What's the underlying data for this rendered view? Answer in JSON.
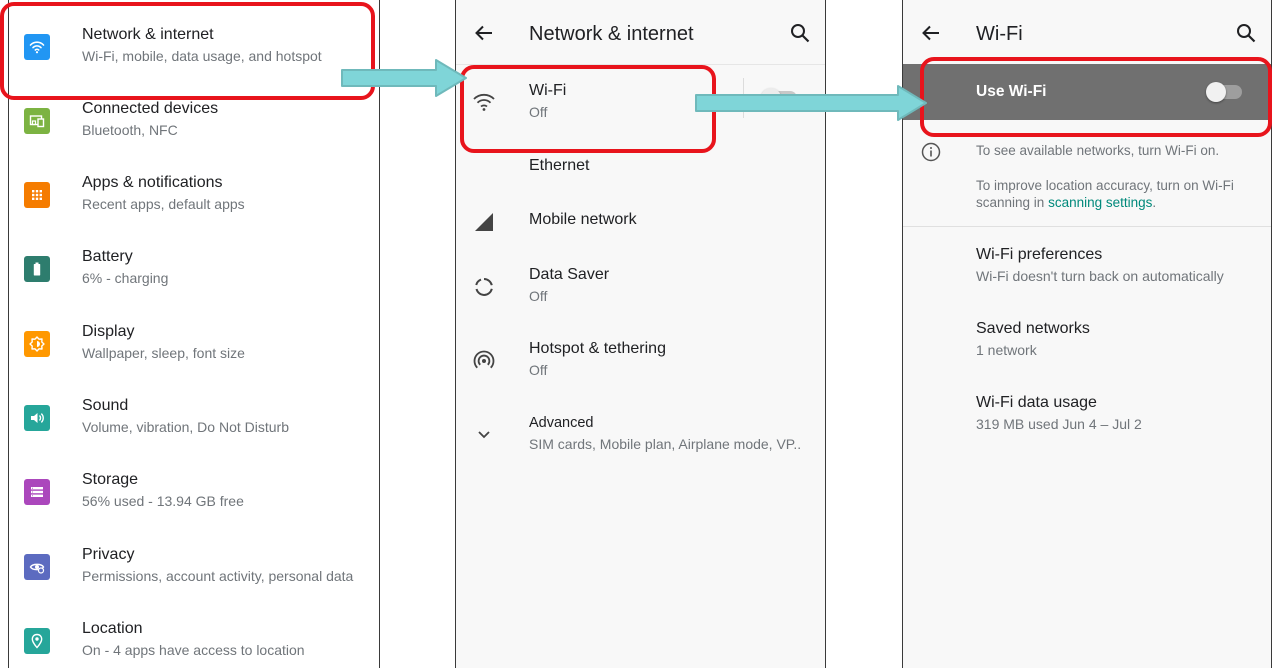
{
  "colors": {
    "highlight": "#e8141c",
    "arrow": "#7fd5d8",
    "link": "#00897b",
    "wifi_bar": "#707070"
  },
  "settings": {
    "items": [
      {
        "title": "Network & internet",
        "subtitle": "Wi-Fi, mobile, data usage, and hotspot",
        "icon": "wifi-icon",
        "color": "#2196f3"
      },
      {
        "title": "Connected devices",
        "subtitle": "Bluetooth, NFC",
        "icon": "connected-devices-icon",
        "color": "#7cb342"
      },
      {
        "title": "Apps & notifications",
        "subtitle": "Recent apps, default apps",
        "icon": "apps-grid-icon",
        "color": "#f57c00"
      },
      {
        "title": "Battery",
        "subtitle": "6% - charging",
        "icon": "battery-icon",
        "color": "#2e7d6e"
      },
      {
        "title": "Display",
        "subtitle": "Wallpaper, sleep, font size",
        "icon": "brightness-icon",
        "color": "#ff9800"
      },
      {
        "title": "Sound",
        "subtitle": "Volume, vibration, Do Not Disturb",
        "icon": "speaker-icon",
        "color": "#26a69a"
      },
      {
        "title": "Storage",
        "subtitle": "56% used - 13.94 GB free",
        "icon": "storage-icon",
        "color": "#ab47bc"
      },
      {
        "title": "Privacy",
        "subtitle": "Permissions, account activity, personal data",
        "icon": "privacy-eye-icon",
        "color": "#5c6bc0"
      },
      {
        "title": "Location",
        "subtitle": "On - 4 apps have access to location",
        "icon": "location-pin-icon",
        "color": "#26a69a"
      }
    ]
  },
  "network": {
    "title": "Network & internet",
    "items": [
      {
        "title": "Wi-Fi",
        "subtitle": "Off",
        "icon": "wifi-outline-icon"
      },
      {
        "title": "Ethernet",
        "subtitle": "",
        "icon": ""
      },
      {
        "title": "Mobile network",
        "subtitle": "",
        "icon": "signal-icon"
      },
      {
        "title": "Data Saver",
        "subtitle": "Off",
        "icon": "data-saver-icon"
      },
      {
        "title": "Hotspot & tethering",
        "subtitle": "Off",
        "icon": "hotspot-icon"
      },
      {
        "title": "Advanced",
        "subtitle": "SIM cards, Mobile plan, Airplane mode, VP..",
        "icon": "chevron-down-icon"
      }
    ]
  },
  "wifi": {
    "title": "Wi-Fi",
    "use_wifi_label": "Use Wi-Fi",
    "use_wifi_on": false,
    "info_text_1": "To see available networks, turn Wi-Fi on.",
    "info_text_2_prefix": "To improve location accuracy, turn on Wi-Fi scanning in ",
    "info_text_2_link": "scanning settings",
    "info_text_2_suffix": ".",
    "items": [
      {
        "title": "Wi-Fi preferences",
        "subtitle": "Wi-Fi doesn't turn back on automatically"
      },
      {
        "title": "Saved networks",
        "subtitle": "1 network"
      },
      {
        "title": "Wi-Fi data usage",
        "subtitle": "319 MB used Jun 4 – Jul 2"
      }
    ]
  }
}
